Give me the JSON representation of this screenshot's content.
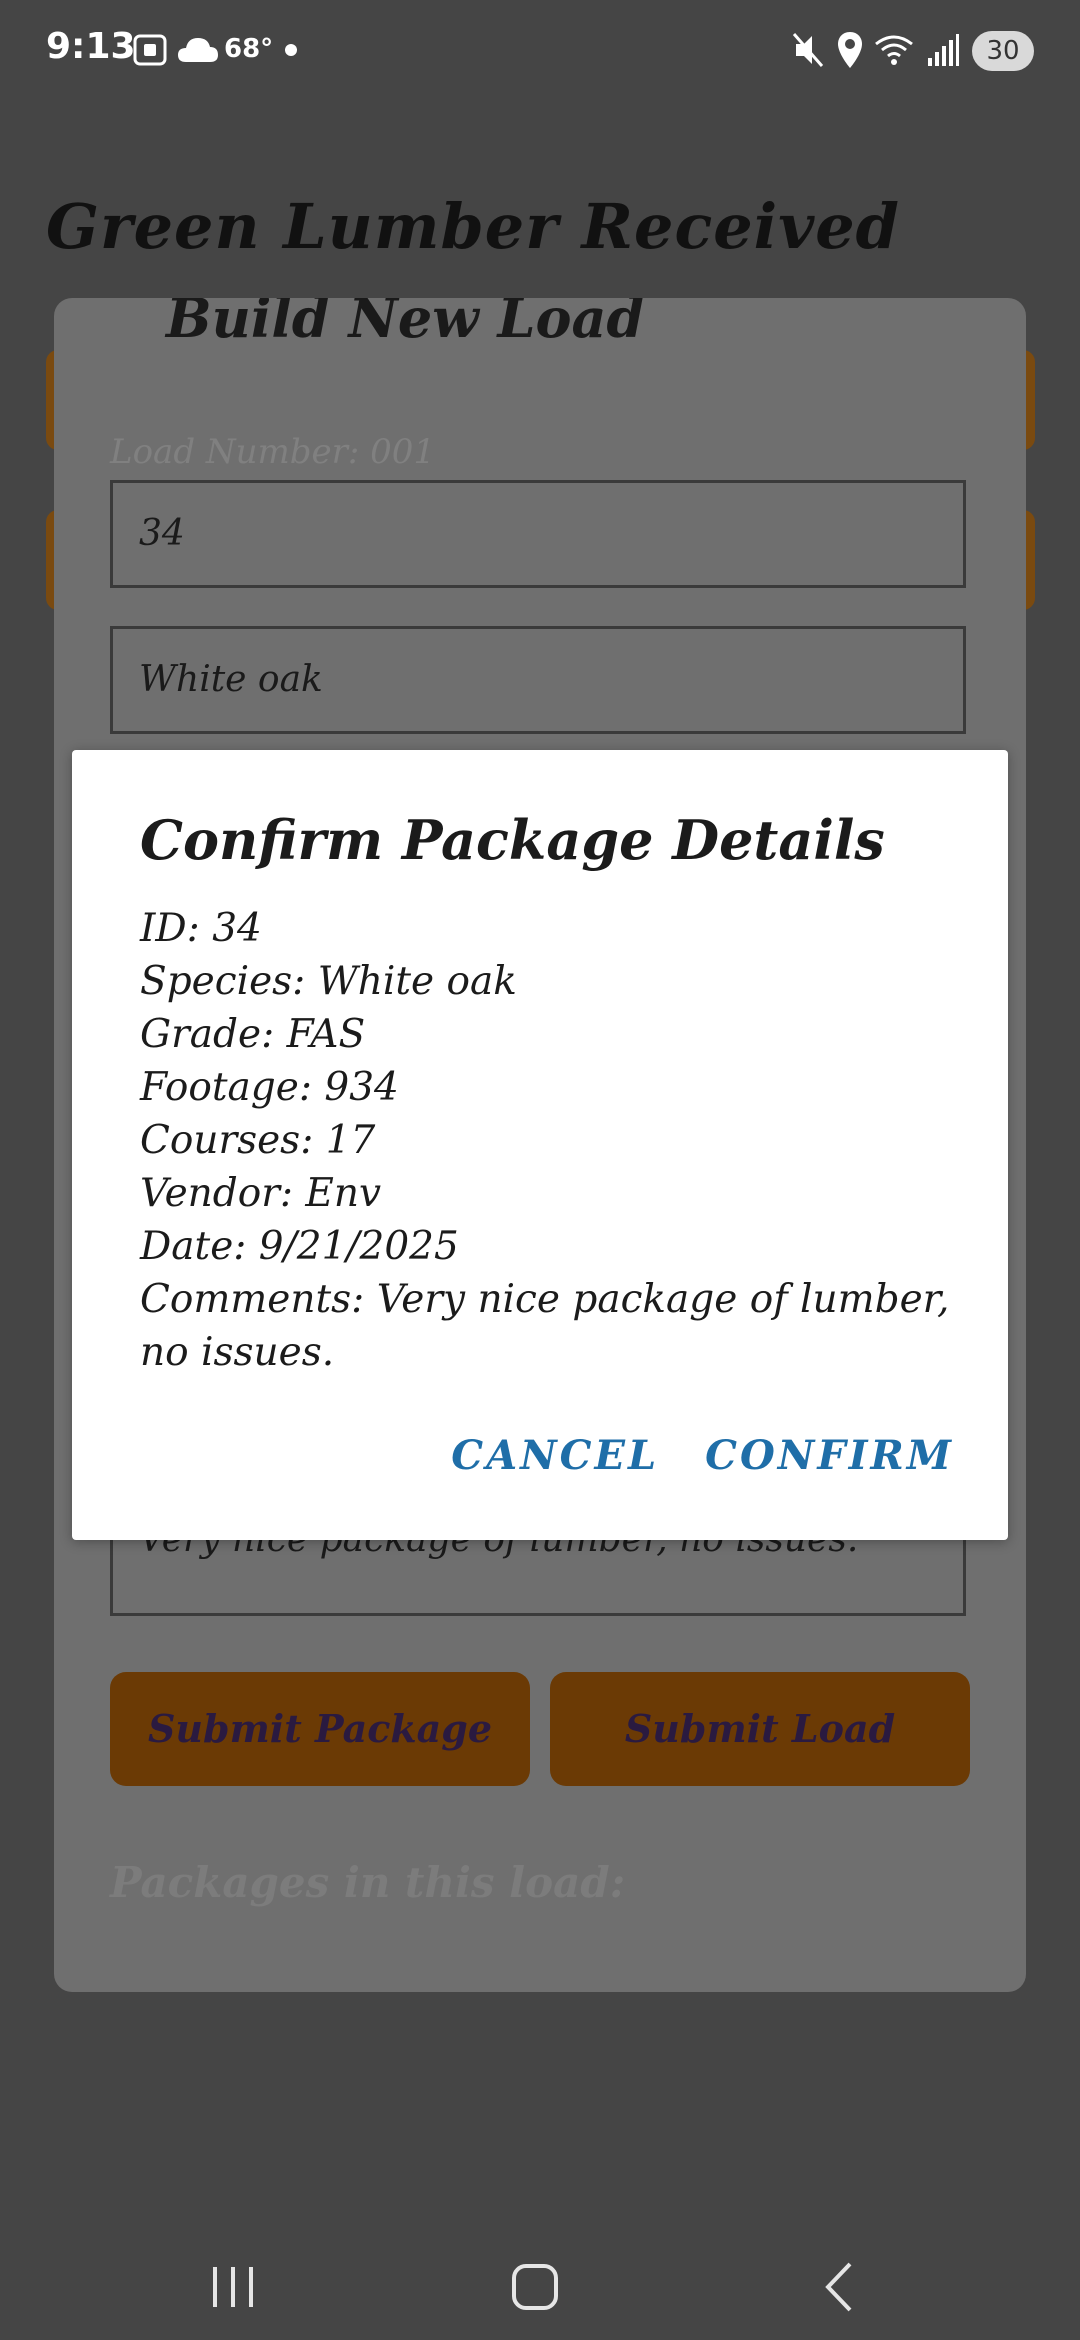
{
  "status_bar": {
    "time": "9:13",
    "temperature": "68°",
    "battery": "30"
  },
  "app": {
    "title": "Green Lumber Received",
    "panel": {
      "header_partial": "Build New Load",
      "load_number": "Load Number: 001",
      "fields": {
        "id_value": "34",
        "species_value": "White oak",
        "comments_value": "Very nice package of lumber, no issues."
      },
      "submit_package_label": "Submit Package",
      "submit_load_label": "Submit Load",
      "packages_label": "Packages in this load:"
    }
  },
  "dialog": {
    "title": "Confirm Package Details",
    "lines": [
      "ID: 34",
      "Species: White oak",
      "Grade: FAS",
      "Footage: 934",
      "Courses: 17",
      "Vendor: Env",
      "Date: 9/21/2025",
      "Comments: Very nice package of lumber, no issues."
    ],
    "cancel_label": "CANCEL",
    "confirm_label": "CONFIRM",
    "link_color": "#1f6ea8"
  },
  "colors": {
    "scrim": "#454545",
    "button_orange": "#6b3a05"
  },
  "navigation": {
    "icons": [
      "recent-apps-icon",
      "home-icon",
      "back-icon"
    ]
  }
}
